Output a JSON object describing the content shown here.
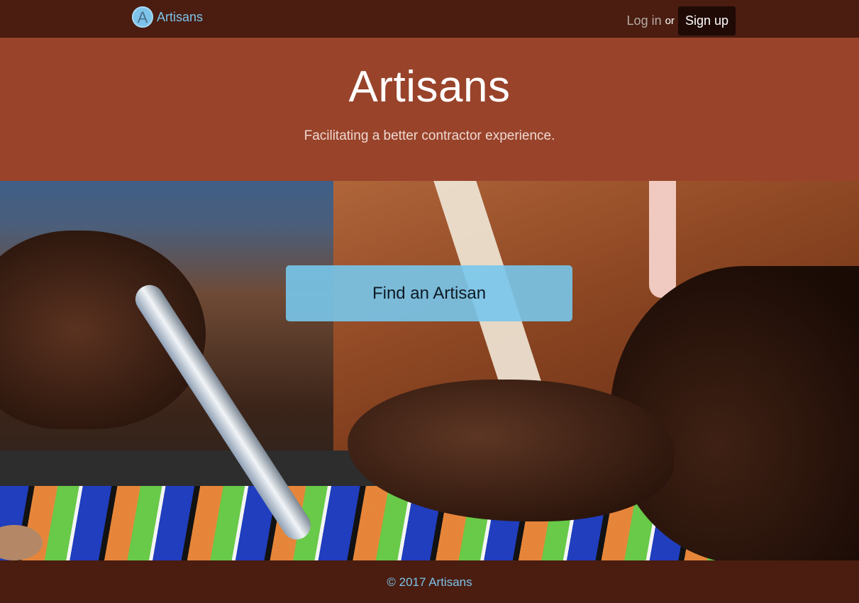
{
  "navbar": {
    "brand_logo_letter": "A",
    "brand_name": "Artisans",
    "login_label": "Log in",
    "or_text": "or",
    "signup_label": "Sign up"
  },
  "hero": {
    "title": "Artisans",
    "subtitle": "Facilitating a better contractor experience."
  },
  "cta": {
    "label": "Find an Artisan"
  },
  "footer": {
    "text": "© 2017 Artisans"
  },
  "colors": {
    "navbar_bg": "#4a1d10",
    "hero_bg": "#99432b",
    "accent": "#7dc3ea",
    "signup_bg": "#1f0a05"
  },
  "icons": {
    "brand_logo": "circle-letter-a-icon"
  }
}
